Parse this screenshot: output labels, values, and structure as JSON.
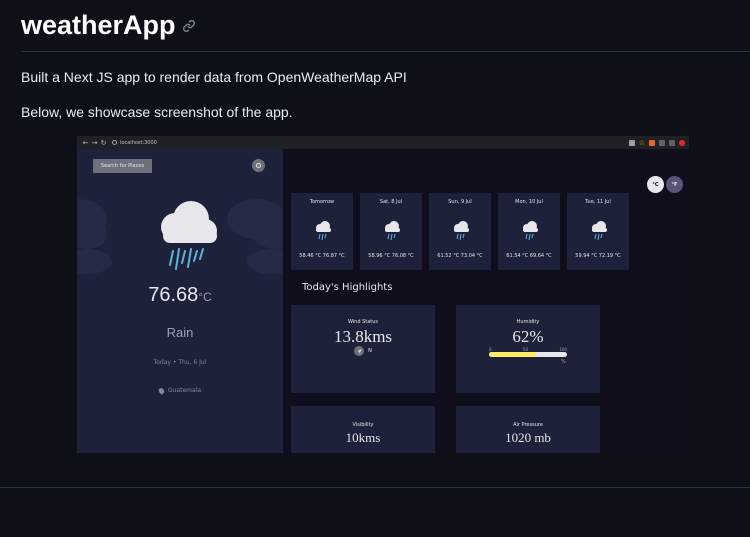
{
  "readme": {
    "title": "weatherApp",
    "paragraph1": "Built a Next JS app to render data from OpenWeatherMap API",
    "paragraph2": "Below, we showcase screenshot of the app."
  },
  "browser": {
    "url": "localhost:3000"
  },
  "app": {
    "search_label": "Search for Places",
    "current_temp": "76.68",
    "current_unit": "°C",
    "condition": "Rain",
    "date_text": "Today • Thu, 6 Jul",
    "location": "Guatemala",
    "unit_c": "°C",
    "unit_f": "°F",
    "forecast": [
      {
        "day": "Tomorrow",
        "range": "58.46 °C  76.87 °C"
      },
      {
        "day": "Sat, 8 Jul",
        "range": "58.96 °C  76.08 °C"
      },
      {
        "day": "Sun, 9 Jul",
        "range": "61.52 °C  73.04 °C"
      },
      {
        "day": "Mon, 10 Jul",
        "range": "61.54 °C  69.64 °C"
      },
      {
        "day": "Tue, 11 Jul",
        "range": "59.94 °C  72.19 °C"
      }
    ],
    "highlights_title": "Today's Highlights",
    "wind": {
      "label": "Wind Status",
      "value": "13.8kms",
      "direction": "N"
    },
    "humidity": {
      "label": "Humidity",
      "value": "62%",
      "percent": 62,
      "scale": [
        "0",
        "50",
        "100"
      ],
      "pct_sign": "%"
    },
    "visibility": {
      "label": "Visibility",
      "value": "10kms"
    },
    "pressure": {
      "label": "Air Pressure",
      "value": "1020 mb"
    }
  },
  "colors": {
    "page_bg": "#0d1117",
    "sidebar_bg": "#1e213a",
    "app_bg": "#100e1d",
    "humidity_fill": "#ffec65"
  }
}
